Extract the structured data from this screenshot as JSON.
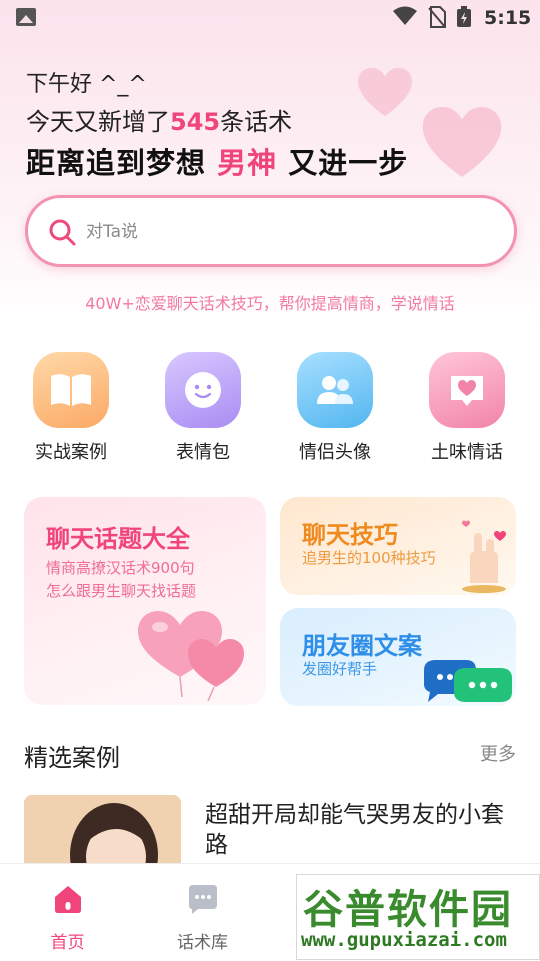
{
  "status_bar": {
    "time": "5:15"
  },
  "hero": {
    "greeting": "下午好 ^_^",
    "line2_prefix": "今天又新增了",
    "line2_count": "545",
    "line2_suffix": "条话术",
    "line3_prefix": "距离追到梦想",
    "line3_highlight": "男神",
    "line3_suffix": "又进一步"
  },
  "search": {
    "placeholder": "对Ta说",
    "value": ""
  },
  "tagline": "40W+恋爱聊天话术技巧，帮你提高情商，学说情话",
  "categories": [
    {
      "label": "实战案例",
      "icon": "open-book-icon",
      "color": "#fbb173"
    },
    {
      "label": "表情包",
      "icon": "smiley-face-icon",
      "color": "#b79af6"
    },
    {
      "label": "情侣头像",
      "icon": "couple-avatar-icon",
      "color": "#69c4f5"
    },
    {
      "label": "土味情话",
      "icon": "heart-message-icon",
      "color": "#f58fb2"
    }
  ],
  "cards": {
    "main": {
      "title": "聊天话题大全",
      "sub1": "情商高撩汉话术900句",
      "sub2": "怎么跟男生聊天找话题"
    },
    "skill": {
      "title": "聊天技巧",
      "sub": "追男生的100种技巧"
    },
    "moments": {
      "title": "朋友圈文案",
      "sub": "发圈好帮手"
    }
  },
  "section": {
    "title": "精选案例",
    "more": "更多"
  },
  "cases": [
    {
      "title": "超甜开局却能气哭男友的小套路"
    }
  ],
  "tabs": [
    {
      "label": "首页",
      "icon": "home-icon",
      "active": true
    },
    {
      "label": "话术库",
      "icon": "chat-bubble-icon",
      "active": false
    }
  ],
  "watermark": {
    "logo": "谷普软件园",
    "url": "www.gupuxiazai.com"
  },
  "colors": {
    "accent": "#f0457a",
    "search_border": "#f293b0"
  }
}
